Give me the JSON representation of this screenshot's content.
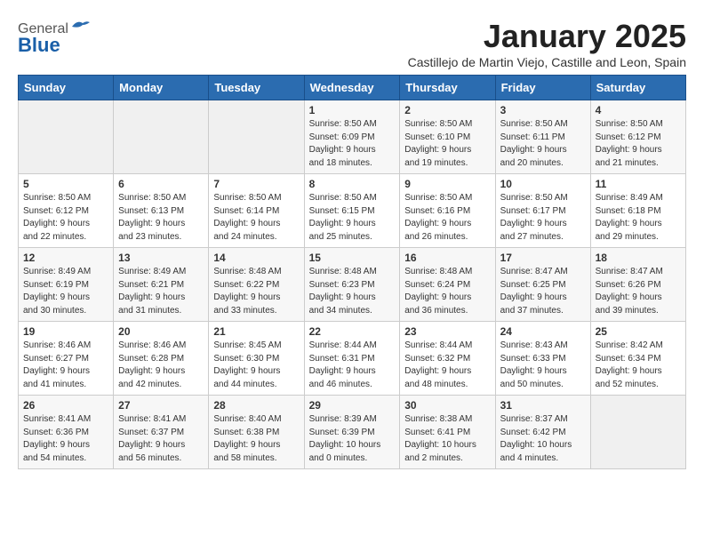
{
  "header": {
    "logo_general": "General",
    "logo_blue": "Blue",
    "month_title": "January 2025",
    "subtitle": "Castillejo de Martin Viejo, Castille and Leon, Spain"
  },
  "weekdays": [
    "Sunday",
    "Monday",
    "Tuesday",
    "Wednesday",
    "Thursday",
    "Friday",
    "Saturday"
  ],
  "weeks": [
    [
      {
        "day": "",
        "info": ""
      },
      {
        "day": "",
        "info": ""
      },
      {
        "day": "",
        "info": ""
      },
      {
        "day": "1",
        "info": "Sunrise: 8:50 AM\nSunset: 6:09 PM\nDaylight: 9 hours\nand 18 minutes."
      },
      {
        "day": "2",
        "info": "Sunrise: 8:50 AM\nSunset: 6:10 PM\nDaylight: 9 hours\nand 19 minutes."
      },
      {
        "day": "3",
        "info": "Sunrise: 8:50 AM\nSunset: 6:11 PM\nDaylight: 9 hours\nand 20 minutes."
      },
      {
        "day": "4",
        "info": "Sunrise: 8:50 AM\nSunset: 6:12 PM\nDaylight: 9 hours\nand 21 minutes."
      }
    ],
    [
      {
        "day": "5",
        "info": "Sunrise: 8:50 AM\nSunset: 6:12 PM\nDaylight: 9 hours\nand 22 minutes."
      },
      {
        "day": "6",
        "info": "Sunrise: 8:50 AM\nSunset: 6:13 PM\nDaylight: 9 hours\nand 23 minutes."
      },
      {
        "day": "7",
        "info": "Sunrise: 8:50 AM\nSunset: 6:14 PM\nDaylight: 9 hours\nand 24 minutes."
      },
      {
        "day": "8",
        "info": "Sunrise: 8:50 AM\nSunset: 6:15 PM\nDaylight: 9 hours\nand 25 minutes."
      },
      {
        "day": "9",
        "info": "Sunrise: 8:50 AM\nSunset: 6:16 PM\nDaylight: 9 hours\nand 26 minutes."
      },
      {
        "day": "10",
        "info": "Sunrise: 8:50 AM\nSunset: 6:17 PM\nDaylight: 9 hours\nand 27 minutes."
      },
      {
        "day": "11",
        "info": "Sunrise: 8:49 AM\nSunset: 6:18 PM\nDaylight: 9 hours\nand 29 minutes."
      }
    ],
    [
      {
        "day": "12",
        "info": "Sunrise: 8:49 AM\nSunset: 6:19 PM\nDaylight: 9 hours\nand 30 minutes."
      },
      {
        "day": "13",
        "info": "Sunrise: 8:49 AM\nSunset: 6:21 PM\nDaylight: 9 hours\nand 31 minutes."
      },
      {
        "day": "14",
        "info": "Sunrise: 8:48 AM\nSunset: 6:22 PM\nDaylight: 9 hours\nand 33 minutes."
      },
      {
        "day": "15",
        "info": "Sunrise: 8:48 AM\nSunset: 6:23 PM\nDaylight: 9 hours\nand 34 minutes."
      },
      {
        "day": "16",
        "info": "Sunrise: 8:48 AM\nSunset: 6:24 PM\nDaylight: 9 hours\nand 36 minutes."
      },
      {
        "day": "17",
        "info": "Sunrise: 8:47 AM\nSunset: 6:25 PM\nDaylight: 9 hours\nand 37 minutes."
      },
      {
        "day": "18",
        "info": "Sunrise: 8:47 AM\nSunset: 6:26 PM\nDaylight: 9 hours\nand 39 minutes."
      }
    ],
    [
      {
        "day": "19",
        "info": "Sunrise: 8:46 AM\nSunset: 6:27 PM\nDaylight: 9 hours\nand 41 minutes."
      },
      {
        "day": "20",
        "info": "Sunrise: 8:46 AM\nSunset: 6:28 PM\nDaylight: 9 hours\nand 42 minutes."
      },
      {
        "day": "21",
        "info": "Sunrise: 8:45 AM\nSunset: 6:30 PM\nDaylight: 9 hours\nand 44 minutes."
      },
      {
        "day": "22",
        "info": "Sunrise: 8:44 AM\nSunset: 6:31 PM\nDaylight: 9 hours\nand 46 minutes."
      },
      {
        "day": "23",
        "info": "Sunrise: 8:44 AM\nSunset: 6:32 PM\nDaylight: 9 hours\nand 48 minutes."
      },
      {
        "day": "24",
        "info": "Sunrise: 8:43 AM\nSunset: 6:33 PM\nDaylight: 9 hours\nand 50 minutes."
      },
      {
        "day": "25",
        "info": "Sunrise: 8:42 AM\nSunset: 6:34 PM\nDaylight: 9 hours\nand 52 minutes."
      }
    ],
    [
      {
        "day": "26",
        "info": "Sunrise: 8:41 AM\nSunset: 6:36 PM\nDaylight: 9 hours\nand 54 minutes."
      },
      {
        "day": "27",
        "info": "Sunrise: 8:41 AM\nSunset: 6:37 PM\nDaylight: 9 hours\nand 56 minutes."
      },
      {
        "day": "28",
        "info": "Sunrise: 8:40 AM\nSunset: 6:38 PM\nDaylight: 9 hours\nand 58 minutes."
      },
      {
        "day": "29",
        "info": "Sunrise: 8:39 AM\nSunset: 6:39 PM\nDaylight: 10 hours\nand 0 minutes."
      },
      {
        "day": "30",
        "info": "Sunrise: 8:38 AM\nSunset: 6:41 PM\nDaylight: 10 hours\nand 2 minutes."
      },
      {
        "day": "31",
        "info": "Sunrise: 8:37 AM\nSunset: 6:42 PM\nDaylight: 10 hours\nand 4 minutes."
      },
      {
        "day": "",
        "info": ""
      }
    ]
  ]
}
